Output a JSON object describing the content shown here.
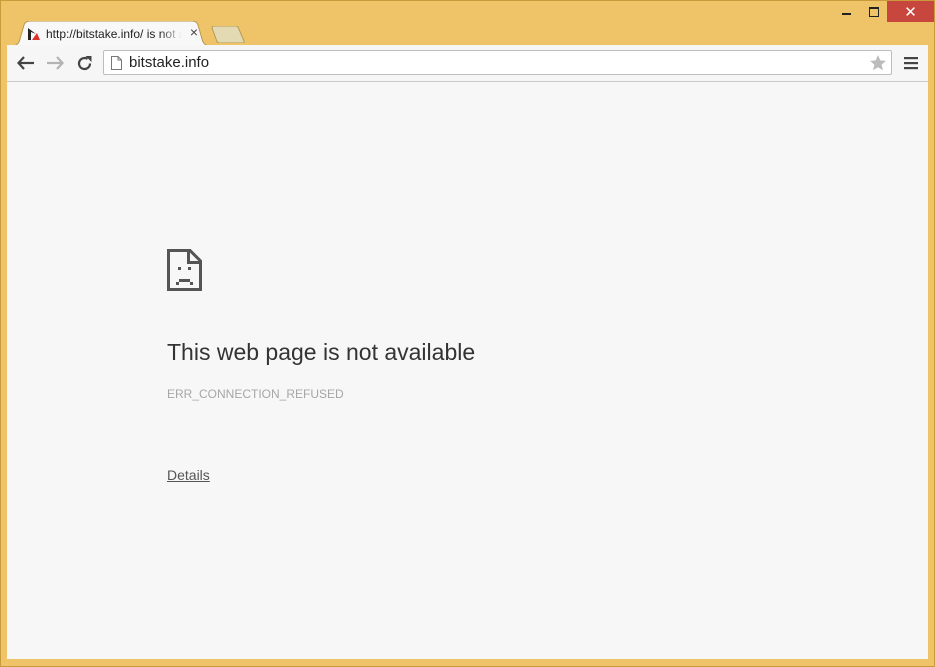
{
  "window": {
    "colors": {
      "frame": "#efc468",
      "close_button": "#c7463e",
      "content_background": "#f7f7f7"
    }
  },
  "tab": {
    "title": "http://bitstake.info/ is not available",
    "close_glyph": "×",
    "favicon": "bitstake-logo-icon"
  },
  "window_controls": {
    "close_glyph": "✕"
  },
  "toolbar": {
    "back_icon": "arrow-left-icon",
    "forward_icon": "arrow-right-icon",
    "reload_icon": "reload-icon",
    "page_icon": "page-icon",
    "bookmark_icon": "star-icon",
    "menu_icon": "hamburger-icon"
  },
  "omnibox": {
    "value": "bitstake.info"
  },
  "error": {
    "icon": "sad-page-icon",
    "title": "This web page is not available",
    "code": "ERR_CONNECTION_REFUSED",
    "details_label": "Details"
  }
}
